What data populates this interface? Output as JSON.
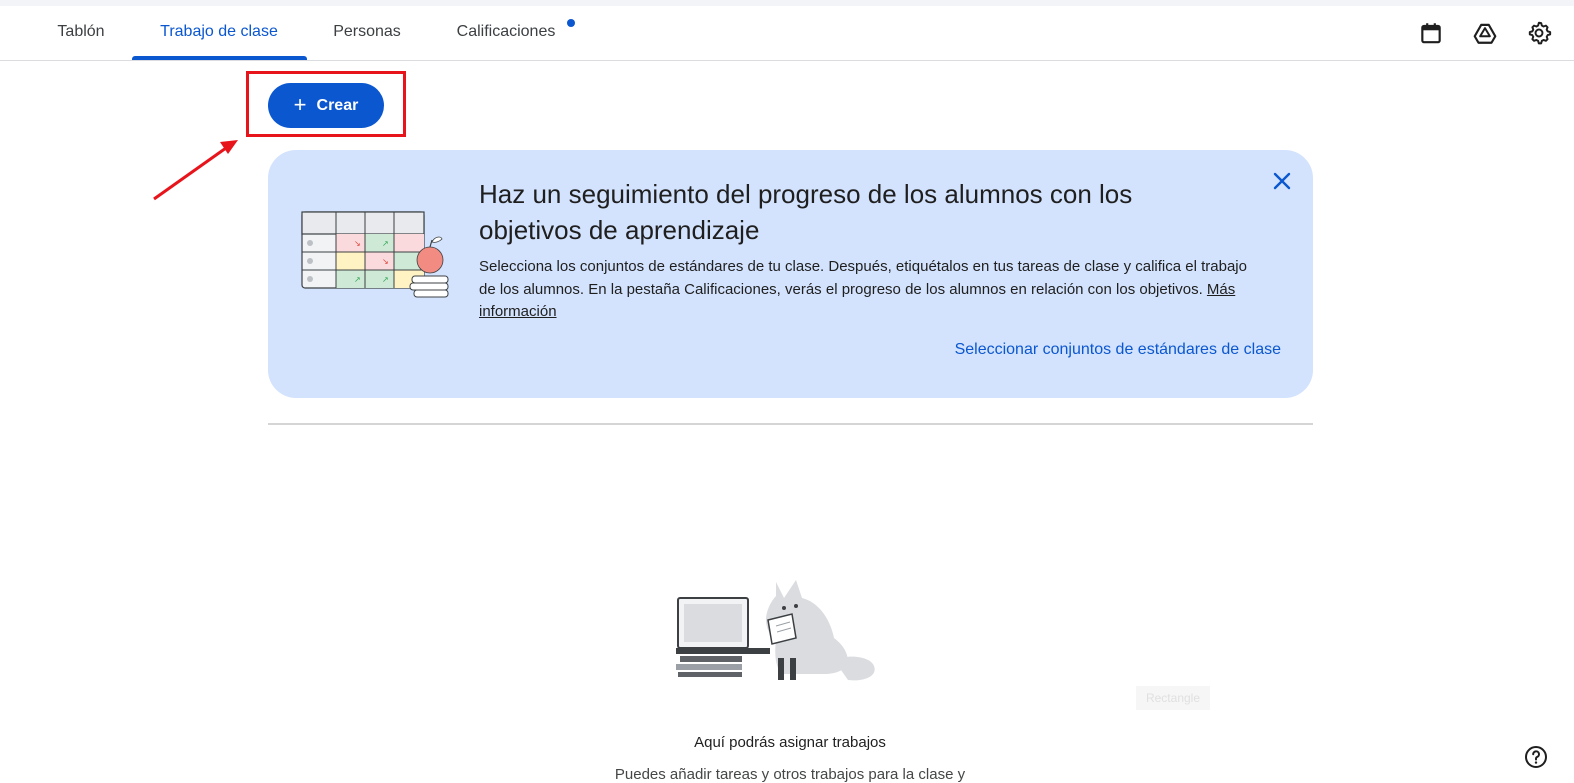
{
  "nav": {
    "tabs": [
      {
        "label": "Tablón"
      },
      {
        "label": "Trabajo de clase"
      },
      {
        "label": "Personas"
      },
      {
        "label": "Calificaciones"
      }
    ],
    "active_tab": "Trabajo de clase",
    "icons": [
      "calendar-icon",
      "drive-icon",
      "settings-icon"
    ]
  },
  "create_button": {
    "label": "Crear",
    "icon": "plus-icon"
  },
  "banner": {
    "title": "Haz un seguimiento del progreso de los alumnos con los objetivos de aprendizaje",
    "body": "Selecciona los conjuntos de estándares de tu clase. Después, etiquétalos en tus tareas de clase y califica el trabajo de los alumnos. En la pestaña Calificaciones, verás el progreso de los alumnos en relación con los objetivos.",
    "link": "Más información",
    "action": "Seleccionar conjuntos de estándares de clase"
  },
  "empty_state": {
    "title": "Aquí podrás asignar trabajos",
    "subtitle": "Puedes añadir tareas y otros trabajos para la clase y"
  },
  "ghost_label": "Rectangle",
  "colors": {
    "accent": "#0b57d0",
    "banner_bg": "#d3e3fd",
    "annotation_red": "#e8141b"
  }
}
